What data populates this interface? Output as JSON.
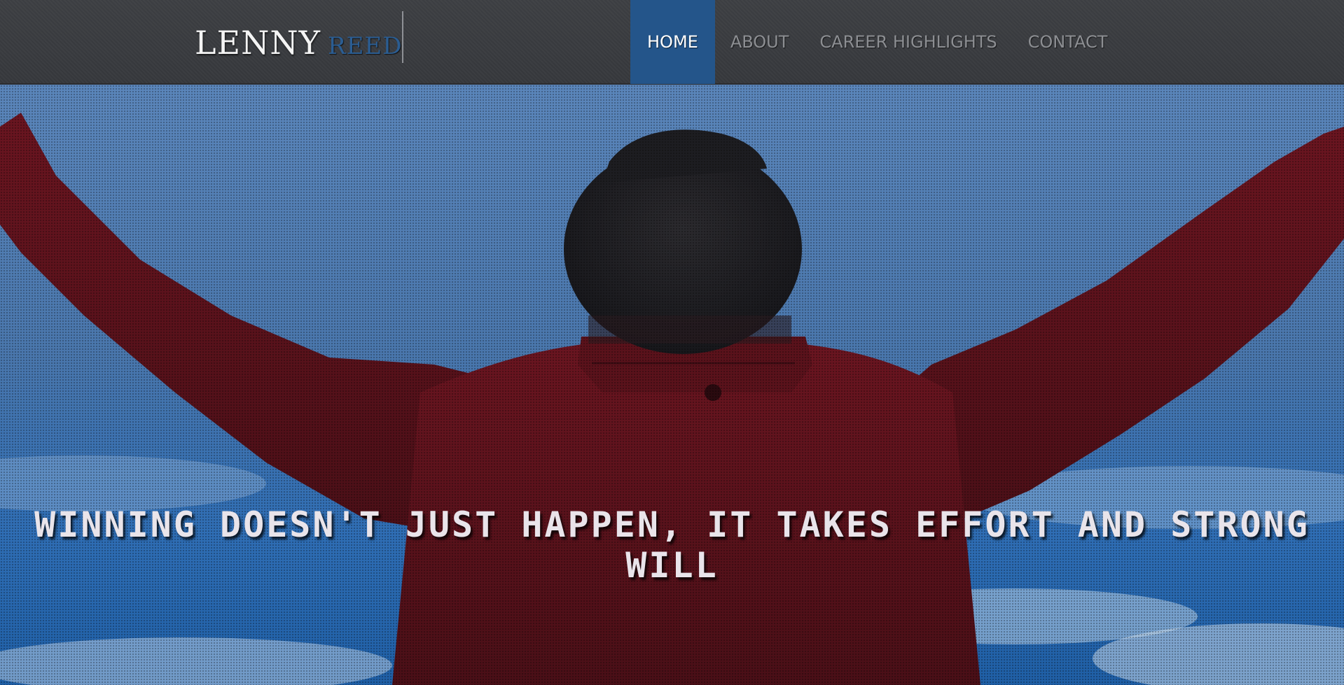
{
  "brand": {
    "first_name": "LENNY",
    "last_name": "REED"
  },
  "nav": {
    "items": [
      {
        "label": "HOME",
        "active": true
      },
      {
        "label": "ABOUT",
        "active": false
      },
      {
        "label": "CAREER HIGHLIGHTS",
        "active": false
      },
      {
        "label": "CONTACT",
        "active": false
      }
    ]
  },
  "hero": {
    "headline": "WINNING DOESN'T JUST HAPPEN, IT TAKES EFFORT AND STRONG WILL"
  },
  "colors": {
    "navbar_bg": "#3a3c40",
    "accent_blue": "#24558a",
    "brand_last_name": "#2b5d92",
    "nav_text": "#8c8e92",
    "headline_text": "#e9e4ea",
    "jacket_red": "#6e1a22",
    "sky_blue": "#4f7fb5"
  }
}
